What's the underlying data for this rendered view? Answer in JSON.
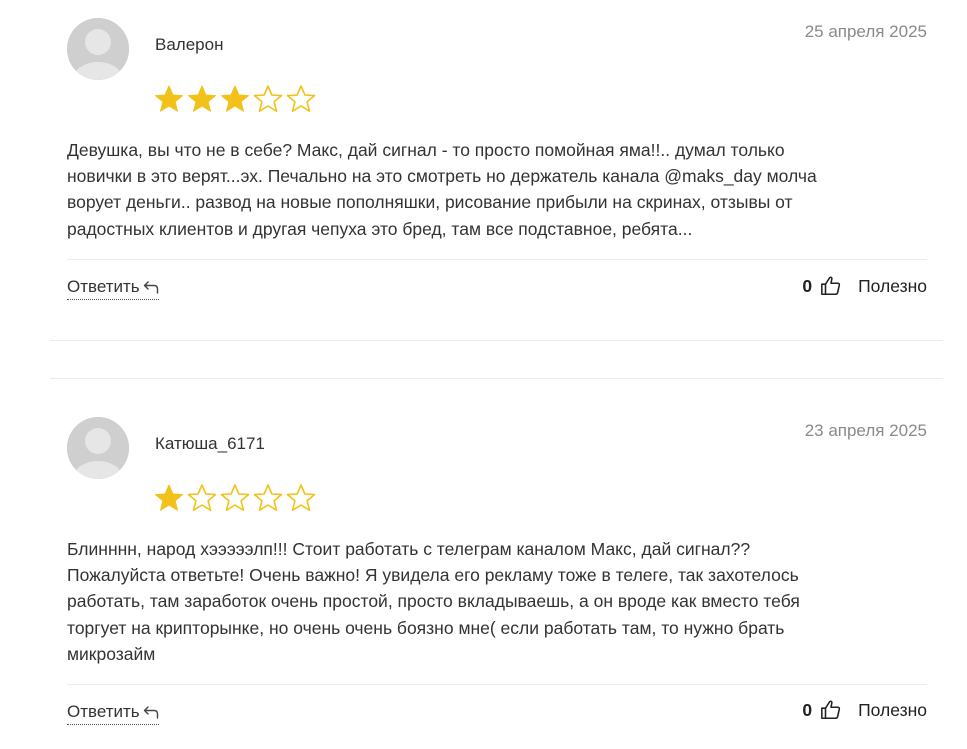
{
  "reviews": [
    {
      "author": "Валерон",
      "date": "25 апреля 2025",
      "rating": 3,
      "max_rating": 5,
      "text_lines": [
        "Девушка, вы что не в себе? Макс, дай сигнал - то просто помойная яма!!.. думал только",
        "новички в это верят...эх. Печально на это смотреть но держатель канала @maks_day молча",
        "ворует деньги.. развод на новые пополняшки, рисование прибыли на скринах, отзывы от",
        "радостных клиентов и другая чепуха это бред, там все подставное, ребята..."
      ],
      "reply_label": "Ответить",
      "likes": "0",
      "useful_label": "Полезно"
    },
    {
      "author": "Катюша_6171",
      "date": "23 апреля 2025",
      "rating": 1,
      "max_rating": 5,
      "text_lines": [
        "Блинннн, народ хэээээлп!!! Стоит работать с телеграм каналом Макс, дай сигнал??",
        "Пожалуйста ответьте! Очень важно! Я увидела его рекламу тоже в телеге, так захотелось",
        "работать, там заработок очень простой, просто вкладываешь, а он вроде как вместо тебя",
        "торгует на крипторынке, но очень очень боязно мне( если работать там, то нужно брать",
        "микрозайм"
      ],
      "reply_label": "Ответить",
      "likes": "0",
      "useful_label": "Полезно"
    }
  ],
  "colors": {
    "star_filled": "#f2c21b",
    "star_outline": "#f2c21b",
    "avatar_bg": "#cfcfcf",
    "date": "#8a8a8a"
  }
}
